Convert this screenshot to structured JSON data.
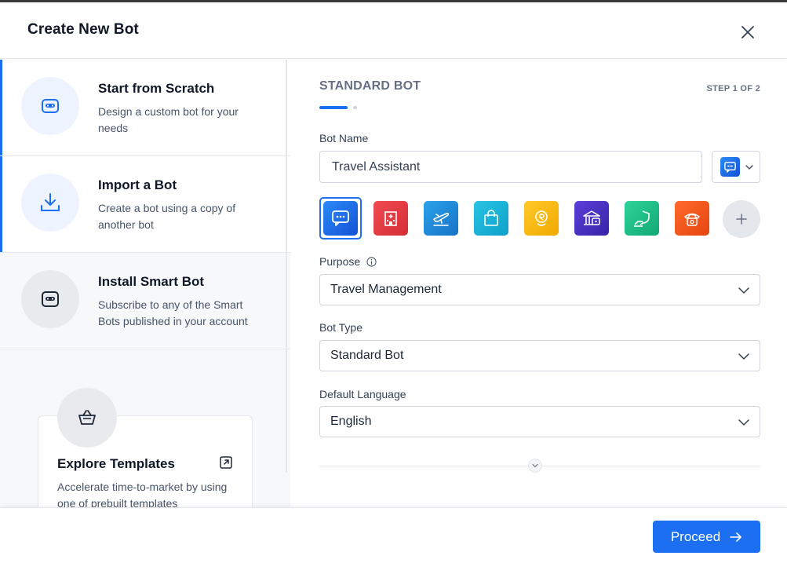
{
  "dialog": {
    "title": "Create New Bot"
  },
  "options": [
    {
      "title": "Start from Scratch",
      "desc": "Design a custom bot for your needs",
      "icon": "bot-icon"
    },
    {
      "title": "Import a Bot",
      "desc": "Create a bot using a copy of another bot",
      "icon": "download-icon"
    },
    {
      "title": "Install Smart Bot",
      "desc": "Subscribe to any of the Smart Bots published in your account",
      "icon": "smart-bot-icon"
    }
  ],
  "templates": {
    "title": "Explore Templates",
    "desc": "Accelerate time-to-market by using one of prebuilt templates"
  },
  "form": {
    "section_title": "STANDARD BOT",
    "step": "STEP 1 OF 2",
    "bot_name_label": "Bot Name",
    "bot_name_value": "Travel Assistant",
    "purpose_label": "Purpose",
    "purpose_value": "Travel Management",
    "bot_type_label": "Bot Type",
    "bot_type_value": "Standard Bot",
    "language_label": "Default Language",
    "language_value": "English"
  },
  "bot_icons": [
    {
      "name": "chat-bubble-icon",
      "color": "#1d6ff2",
      "selected": true
    },
    {
      "name": "hospital-icon",
      "color": "#e5373f",
      "selected": false
    },
    {
      "name": "airplane-icon",
      "color": "#1c8fdc",
      "selected": false
    },
    {
      "name": "shopping-bag-icon",
      "color": "#18b3d6",
      "selected": false
    },
    {
      "name": "finance-icon",
      "color": "#f5b700",
      "selected": false
    },
    {
      "name": "bank-icon",
      "color": "#4b33c6",
      "selected": false
    },
    {
      "name": "insurance-icon",
      "color": "#1dbf86",
      "selected": false
    },
    {
      "name": "telephone-icon",
      "color": "#f2561d",
      "selected": false
    }
  ],
  "footer": {
    "proceed_label": "Proceed"
  },
  "colors": {
    "accent": "#1d6ff2"
  }
}
